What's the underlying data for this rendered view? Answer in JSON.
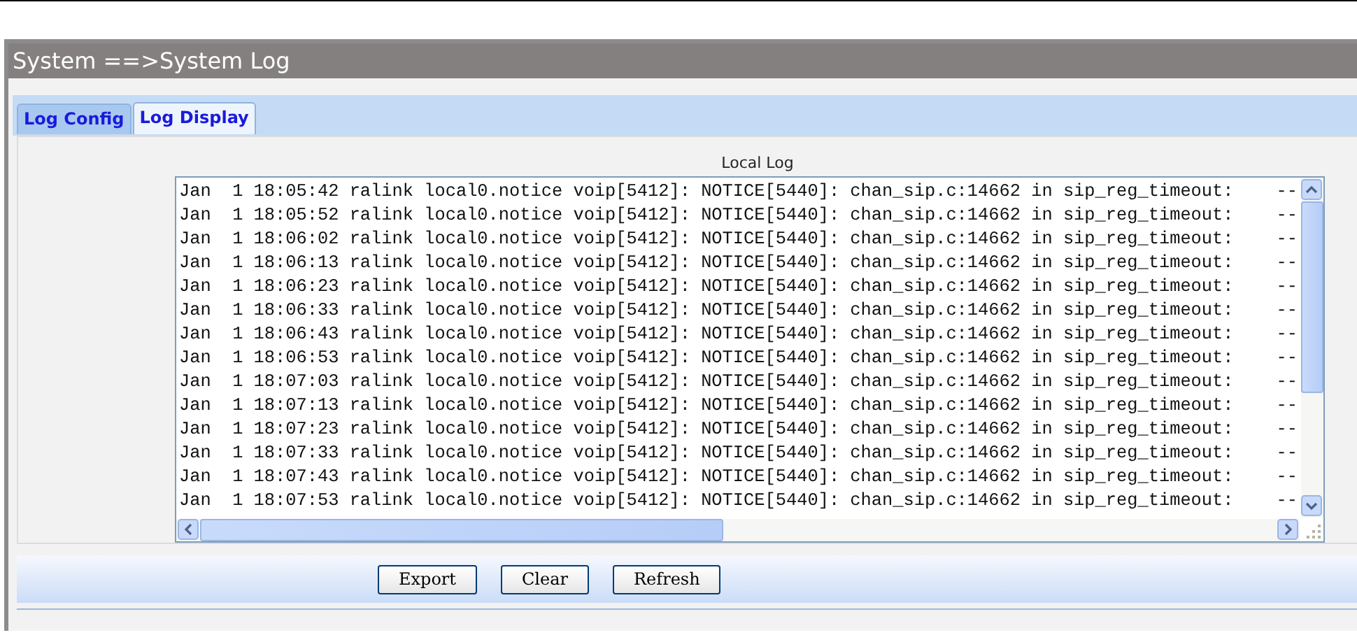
{
  "breadcrumb": "System ==>System Log",
  "tabs": [
    {
      "label": "Log Config",
      "selected": false
    },
    {
      "label": "Log Display",
      "selected": true
    }
  ],
  "log": {
    "title": "Local Log",
    "lines": [
      "Jan  1 18:05:42 ralink local0.notice voip[5412]: NOTICE[5440]: chan_sip.c:14662 in sip_reg_timeout:    --",
      "Jan  1 18:05:52 ralink local0.notice voip[5412]: NOTICE[5440]: chan_sip.c:14662 in sip_reg_timeout:    --",
      "Jan  1 18:06:02 ralink local0.notice voip[5412]: NOTICE[5440]: chan_sip.c:14662 in sip_reg_timeout:    --",
      "Jan  1 18:06:13 ralink local0.notice voip[5412]: NOTICE[5440]: chan_sip.c:14662 in sip_reg_timeout:    --",
      "Jan  1 18:06:23 ralink local0.notice voip[5412]: NOTICE[5440]: chan_sip.c:14662 in sip_reg_timeout:    --",
      "Jan  1 18:06:33 ralink local0.notice voip[5412]: NOTICE[5440]: chan_sip.c:14662 in sip_reg_timeout:    --",
      "Jan  1 18:06:43 ralink local0.notice voip[5412]: NOTICE[5440]: chan_sip.c:14662 in sip_reg_timeout:    --",
      "Jan  1 18:06:53 ralink local0.notice voip[5412]: NOTICE[5440]: chan_sip.c:14662 in sip_reg_timeout:    --",
      "Jan  1 18:07:03 ralink local0.notice voip[5412]: NOTICE[5440]: chan_sip.c:14662 in sip_reg_timeout:    --",
      "Jan  1 18:07:13 ralink local0.notice voip[5412]: NOTICE[5440]: chan_sip.c:14662 in sip_reg_timeout:    --",
      "Jan  1 18:07:23 ralink local0.notice voip[5412]: NOTICE[5440]: chan_sip.c:14662 in sip_reg_timeout:    --",
      "Jan  1 18:07:33 ralink local0.notice voip[5412]: NOTICE[5440]: chan_sip.c:14662 in sip_reg_timeout:    --",
      "Jan  1 18:07:43 ralink local0.notice voip[5412]: NOTICE[5440]: chan_sip.c:14662 in sip_reg_timeout:    --",
      "Jan  1 18:07:53 ralink local0.notice voip[5412]: NOTICE[5440]: chan_sip.c:14662 in sip_reg_timeout:    --"
    ]
  },
  "buttons": [
    "Export",
    "Clear",
    "Refresh"
  ]
}
